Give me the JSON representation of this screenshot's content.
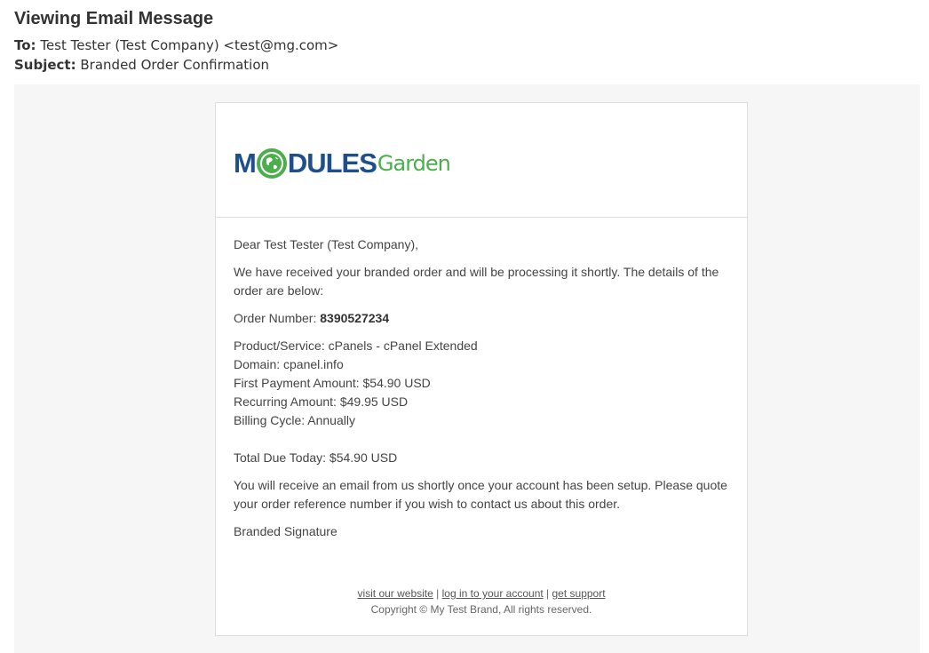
{
  "header": {
    "title": "Viewing Email Message",
    "to_label": "To:",
    "to_value": "Test Tester (Test Company) <test@mg.com>",
    "subject_label": "Subject:",
    "subject_value": "Branded Order Confirmation"
  },
  "email": {
    "logo": {
      "word1": "M",
      "word2": "DULES",
      "word3": "Garden",
      "icon": "globe-icon"
    },
    "greeting": "Dear Test Tester (Test Company),",
    "intro": "We have received your branded order and will be processing it shortly. The details of the order are below:",
    "order_number_label": "Order Number: ",
    "order_number": "8390527234",
    "details": [
      "Product/Service: cPanels - cPanel Extended",
      "Domain: cpanel.info",
      "First Payment Amount: $54.90 USD",
      "Recurring Amount: $49.95 USD",
      "Billing Cycle: Annually"
    ],
    "total": "Total Due Today: $54.90 USD",
    "closing": "You will receive an email from us shortly once your account has been setup. Please quote your order reference number if you wish to contact us about this order.",
    "signature": "Branded Signature",
    "footer": {
      "link_website": "visit our website",
      "sep": " | ",
      "link_login": "log in to your account",
      "link_support": "get support",
      "copyright": "Copyright © My Test Brand, All rights reserved."
    }
  },
  "colors": {
    "brand_blue": "#1f4e8c",
    "brand_green": "#4cae4c",
    "stage_bg": "#f6f6f6"
  }
}
